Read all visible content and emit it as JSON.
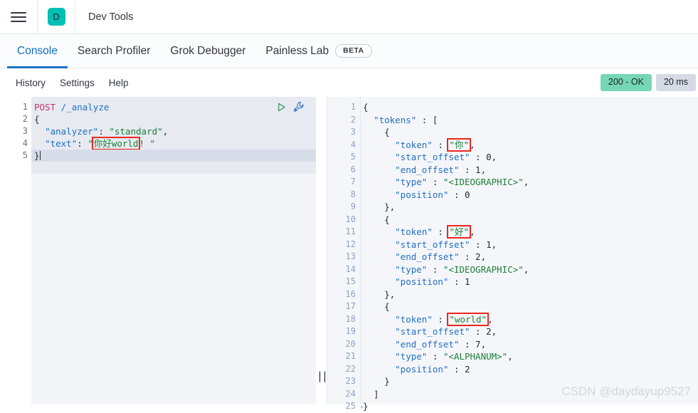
{
  "header": {
    "menu_icon": "hamburger-icon",
    "logo_letter": "D",
    "logo_color": "#00bfb3",
    "title": "Dev Tools"
  },
  "tabs": [
    {
      "label": "Console",
      "active": true,
      "badge": null
    },
    {
      "label": "Search Profiler",
      "active": false,
      "badge": null
    },
    {
      "label": "Grok Debugger",
      "active": false,
      "badge": null
    },
    {
      "label": "Painless Lab",
      "active": false,
      "badge": "BETA"
    }
  ],
  "actions": {
    "links": [
      "History",
      "Settings",
      "Help"
    ],
    "status_code": "200 - OK",
    "status_color": "#75d7b5",
    "duration": "20 ms",
    "duration_color": "#d5dae4"
  },
  "request": {
    "run_icon": "play-icon",
    "wrench_icon": "wrench-icon",
    "lines": [
      {
        "num": "1",
        "fold": ""
      },
      {
        "num": "2",
        "fold": "▾"
      },
      {
        "num": "3",
        "fold": ""
      },
      {
        "num": "4",
        "fold": ""
      },
      {
        "num": "5",
        "fold": "▴"
      }
    ],
    "method": "POST",
    "path": "/_analyze",
    "body_open": "{",
    "analyzer_key": "\"analyzer\"",
    "analyzer_val": "\"standard\"",
    "text_key": "\"text\"",
    "text_quote_open": "\"",
    "text_highlight": "你好world",
    "text_rest": "! ",
    "text_quote_close": "\"",
    "body_close": "}"
  },
  "response": {
    "lines": [
      {
        "num": "1",
        "fold": "▾",
        "text": "{"
      },
      {
        "num": "2",
        "fold": "▾",
        "text": "  \"tokens\" : ["
      },
      {
        "num": "3",
        "fold": "▾",
        "text": "    {"
      },
      {
        "num": "4",
        "fold": "",
        "text": "      \"token\" : \"你\","
      },
      {
        "num": "5",
        "fold": "",
        "text": "      \"start_offset\" : 0,"
      },
      {
        "num": "6",
        "fold": "",
        "text": "      \"end_offset\" : 1,"
      },
      {
        "num": "7",
        "fold": "",
        "text": "      \"type\" : \"<IDEOGRAPHIC>\","
      },
      {
        "num": "8",
        "fold": "",
        "text": "      \"position\" : 0"
      },
      {
        "num": "9",
        "fold": "▴",
        "text": "    },"
      },
      {
        "num": "10",
        "fold": "▾",
        "text": "    {"
      },
      {
        "num": "11",
        "fold": "",
        "text": "      \"token\" : \"好\","
      },
      {
        "num": "12",
        "fold": "",
        "text": "      \"start_offset\" : 1,"
      },
      {
        "num": "13",
        "fold": "",
        "text": "      \"end_offset\" : 2,"
      },
      {
        "num": "14",
        "fold": "",
        "text": "      \"type\" : \"<IDEOGRAPHIC>\","
      },
      {
        "num": "15",
        "fold": "",
        "text": "      \"position\" : 1"
      },
      {
        "num": "16",
        "fold": "▴",
        "text": "    },"
      },
      {
        "num": "17",
        "fold": "▾",
        "text": "    {"
      },
      {
        "num": "18",
        "fold": "",
        "text": "      \"token\" : \"world\","
      },
      {
        "num": "19",
        "fold": "",
        "text": "      \"start_offset\" : 2,"
      },
      {
        "num": "20",
        "fold": "",
        "text": "      \"end_offset\" : 7,"
      },
      {
        "num": "21",
        "fold": "",
        "text": "      \"type\" : \"<ALPHANUM>\","
      },
      {
        "num": "22",
        "fold": "",
        "text": "      \"position\" : 2"
      },
      {
        "num": "23",
        "fold": "▴",
        "text": "    }"
      },
      {
        "num": "24",
        "fold": "▴",
        "text": "  ]"
      },
      {
        "num": "25",
        "fold": "▴",
        "text": "}"
      }
    ],
    "tokens_label": "\"tokens\"",
    "highlighted_tokens": [
      "\"你\"",
      "\"好\"",
      "\"world\""
    ]
  },
  "splitter": {
    "grip": "||"
  },
  "watermark": "CSDN @daydayup9527"
}
